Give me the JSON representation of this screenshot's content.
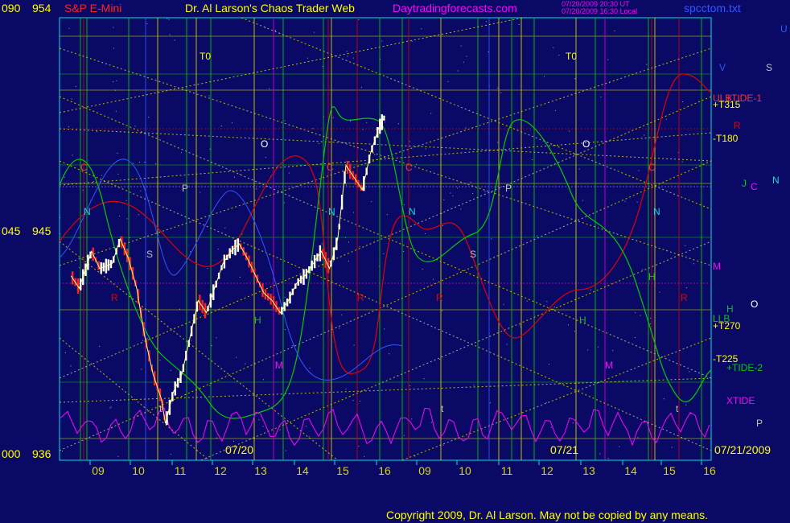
{
  "header": {
    "left_top_code": "090",
    "left_top_price": "954",
    "symbol": "S&P E-Mini",
    "title": "Dr. Al Larson's Chaos Trader Web",
    "site": "Daytradingforecasts.com",
    "stamp_line1": "07/20/2009 20:30 UT",
    "stamp_line2": "07/20/2009 16:30 Local",
    "file": "spcctom.txt"
  },
  "colors": {
    "background": "#0a0a66",
    "plot_border": "#00e0e0",
    "grid_green": "#00cc00",
    "grid_yellow": "#d8d800",
    "vertical_red": "#cc0000",
    "vertical_blue": "#3355ff",
    "vertical_magenta": "#cc00cc",
    "price_up": "#ffffff",
    "price_down": "#ff2020",
    "tide1": "#e00000",
    "tide2": "#00cc00",
    "xtide": "#ff00ff",
    "copyright": "#ffff00"
  },
  "y_axis": [
    {
      "code": "090",
      "price": "954"
    },
    {
      "code": "045",
      "price": "945"
    },
    {
      "code": "000",
      "price": "936"
    }
  ],
  "chart_data": {
    "type": "line",
    "title": "S&P E-Mini",
    "ylim": [
      936,
      954
    ],
    "grid": true,
    "x_hour_labels": [
      "09",
      "10",
      "11",
      "12",
      "13",
      "14",
      "15",
      "16",
      "09",
      "10",
      "11",
      "12",
      "13",
      "14",
      "15",
      "16"
    ],
    "date_labels": [
      "07/20",
      "07/21",
      "07/21/2009"
    ],
    "price_path": {
      "x": [
        8.3,
        8.5,
        8.8,
        9.0,
        9.3,
        9.5,
        9.7,
        9.9,
        10.1,
        10.3,
        10.5,
        10.6,
        10.8,
        11.0,
        11.2,
        11.4,
        11.6,
        11.8,
        12.0,
        12.2,
        12.4,
        12.6,
        12.8,
        13.0,
        13.2,
        13.4,
        13.6,
        13.8,
        14.0,
        14.2,
        14.4,
        14.6,
        14.8,
        15.0,
        15.2,
        15.4,
        15.6,
        15.8,
        15.95
      ],
      "y": [
        943.5,
        943.0,
        944.5,
        943.8,
        944.0,
        945.0,
        944.2,
        943.0,
        941.0,
        939.5,
        938.5,
        937.5,
        938.8,
        939.5,
        941.0,
        942.5,
        942.0,
        943.0,
        944.0,
        944.5,
        944.8,
        944.2,
        943.5,
        942.8,
        942.5,
        942.0,
        942.5,
        943.2,
        943.5,
        944.0,
        944.5,
        943.8,
        945.0,
        948.0,
        947.5,
        947.0,
        948.5,
        949.5,
        950.0
      ]
    },
    "series": [
      {
        "name": "+TIDE-1",
        "color": "#e00000"
      },
      {
        "name": "+TIDE-2",
        "color": "#00cc00"
      },
      {
        "name": "XTIDE",
        "color": "#ff00ff"
      }
    ],
    "right_labels": [
      {
        "text": "U",
        "color": "#3355ff"
      },
      {
        "text": "V",
        "color": "#3355ff"
      },
      {
        "text": "S",
        "color": "#c0c0c0"
      },
      {
        "text": "ULB",
        "color": "#ff3030"
      },
      {
        "text": "+TIDE-1",
        "color": "#ff3030"
      },
      {
        "text": "+T315",
        "color": "#ffff00"
      },
      {
        "text": "R",
        "color": "#e00000"
      },
      {
        "text": "-T180",
        "color": "#ffff00"
      },
      {
        "text": "J",
        "color": "#00cc00"
      },
      {
        "text": "C",
        "color": "#ff00ff"
      },
      {
        "text": "N",
        "color": "#00e0e0"
      },
      {
        "text": "M",
        "color": "#ff00ff"
      },
      {
        "text": "H",
        "color": "#00cc00"
      },
      {
        "text": "O",
        "color": "#ffffff"
      },
      {
        "text": "LLB",
        "color": "#00cc00"
      },
      {
        "text": "+T270",
        "color": "#ffff00"
      },
      {
        "text": "-T225",
        "color": "#ffff00"
      },
      {
        "text": "+TIDE-2",
        "color": "#00cc00"
      },
      {
        "text": "XTIDE",
        "color": "#ff00ff"
      },
      {
        "text": "P",
        "color": "#c0c0c0"
      }
    ],
    "in_chart_labels": [
      "T0",
      "T0",
      "O",
      "O",
      "P",
      "P",
      "C",
      "C",
      "C",
      "C",
      "N",
      "N",
      "N",
      "N",
      "S",
      "S",
      "R",
      "R",
      "R",
      "R",
      "H",
      "H",
      "H",
      "M",
      "M",
      "t",
      "t",
      "t"
    ]
  },
  "copyright": "Copyright 2009, Dr. Al Larson. May not be copied by any means."
}
